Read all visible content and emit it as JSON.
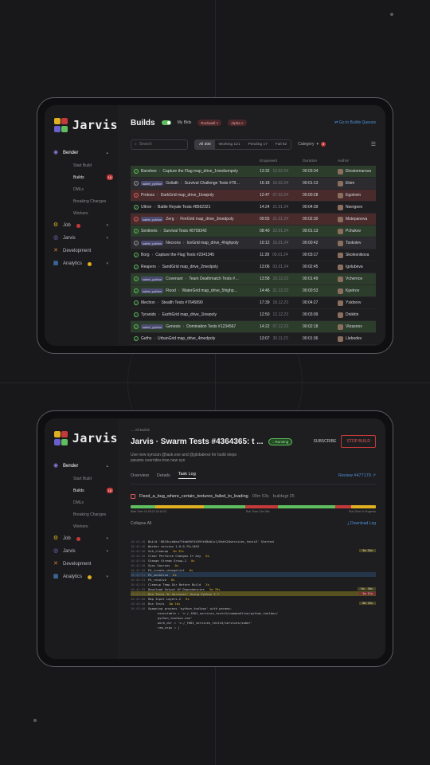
{
  "app_name": "Jarvis",
  "sidebar": {
    "groups": [
      {
        "label": "Bender",
        "icon": "bender-icon",
        "items": [
          {
            "label": "Start Build",
            "active": false
          },
          {
            "label": "Builds",
            "active": true,
            "count": "16"
          },
          {
            "label": "DMLs",
            "active": false
          },
          {
            "label": "Breaking Changes",
            "active": false
          },
          {
            "label": "Workers",
            "active": false
          }
        ]
      },
      {
        "label": "Job",
        "icon": "job-icon",
        "badge_color": "#c43a3a"
      },
      {
        "label": "Jarvis",
        "icon": "jarvis-icon"
      },
      {
        "label": "Development",
        "icon": "development-icon"
      },
      {
        "label": "Analytics",
        "icon": "analytics-icon",
        "badge_color": "#e0b020"
      }
    ]
  },
  "builds": {
    "title": "Builds",
    "toggle_label": "My Blds",
    "chips": [
      "Rockwell",
      "Alpha"
    ],
    "link": "Go to Builds Queues",
    "search_placeholder": "Search",
    "segments": [
      "All 300",
      "Working 121",
      "Pending 17",
      "Fail 62"
    ],
    "category_label": "Category",
    "category_count": "3",
    "columns": [
      "Enqueued",
      "Duration",
      "Author"
    ],
    "rows": [
      {
        "status": "green",
        "tag": "",
        "name": "Banshee",
        "task": "Capture the Flag map_drive_1mediumpoly",
        "time": "13:32",
        "date": "12.02.24",
        "dur": "00:03:34",
        "author": "Ekostomarova"
      },
      {
        "status": "grey",
        "tag": "saber_python",
        "name": "Goliath",
        "task": "Survival Challenge Tests #78…",
        "time": "16:18",
        "date": "10.02.24",
        "dur": "00:01:13",
        "author": "Ekim"
      },
      {
        "status": "red",
        "tag": "",
        "name": "Protoss",
        "task": "DarkGrid map_drive_1lowpoly",
        "time": "12:47",
        "date": "07.02.24",
        "dur": "00:00:28",
        "author": "Egolovin"
      },
      {
        "status": "none",
        "tag": "",
        "name": "Ultron",
        "task": "Battle Royale Tests #8562321",
        "time": "14:24",
        "date": "21.01.24",
        "dur": "00:04:39",
        "author": "Nsergeev"
      },
      {
        "status": "red",
        "tag": "saber_python",
        "name": "Zerg",
        "task": "FireGrid map_drive_3medpoly",
        "time": "09:55",
        "date": "21.01.24",
        "dur": "00:02:30",
        "author": "Mstepanova"
      },
      {
        "status": "green",
        "tag": "",
        "name": "Sentinels",
        "task": "Survival Tests #8759342",
        "time": "08:40",
        "date": "22.01.24",
        "dur": "00:01:13",
        "author": "Pchukov"
      },
      {
        "status": "grey",
        "tag": "saber_python",
        "name": "Necrons",
        "task": "IceGrid map_drive_4highpoly",
        "time": "10:12",
        "date": "15.01.24",
        "dur": "00:00:42",
        "author": "Tsokolev"
      },
      {
        "status": "none",
        "tag": "",
        "name": "Borg",
        "task": "Capture the Flag Tests #2341345",
        "time": "11:28",
        "date": "09.01.24",
        "dur": "00:03:17",
        "author": "Skolesnikova"
      },
      {
        "status": "none",
        "tag": "",
        "name": "Reapers",
        "task": "SandGrid map_drive_2medpoly",
        "time": "13:06",
        "date": "03.01.24",
        "dur": "00:02:45",
        "author": "Igolubeva"
      },
      {
        "status": "green",
        "tag": "saber_python",
        "name": "Covenant",
        "task": "Team Deathmatch Tests #…",
        "time": "13:58",
        "date": "29.12.23",
        "dur": "00:01:49",
        "author": "Vchernov"
      },
      {
        "status": "green",
        "tag": "saber_python",
        "name": "Flood",
        "task": "WaterGrid map_drive_5highp…",
        "time": "14:46",
        "date": "21.12.23",
        "dur": "00:00:53",
        "author": "Kpetrov"
      },
      {
        "status": "none",
        "tag": "",
        "name": "Mechon",
        "task": "Stealth Tests #7645890",
        "time": "17:39",
        "date": "18.12.23",
        "dur": "00:04:27",
        "author": "Ysidorov"
      },
      {
        "status": "none",
        "tag": "",
        "name": "Tyranids",
        "task": "EarthGrid map_drive_1lowpoly",
        "time": "12:50",
        "date": "12.12.23",
        "dur": "00:03:09",
        "author": "Dnikitin"
      },
      {
        "status": "green",
        "tag": "saber_python",
        "name": "Genesis",
        "task": "Domination Tests #1234567",
        "time": "14:22",
        "date": "07.12.23",
        "dur": "00:02:18",
        "author": "Vkrasnov"
      },
      {
        "status": "none",
        "tag": "",
        "name": "Geths",
        "task": "UrbanGrid map_drive_4medpoly",
        "time": "13:07",
        "date": "30.11.23",
        "dur": "00:01:36",
        "author": "Llebedev"
      }
    ]
  },
  "job": {
    "breadcrumb": "All Builds",
    "title": "Jarvis  ·  Swarm Tests #4364365: t ...",
    "status": "Running",
    "subscribe": "SUBSCRIBE",
    "stop": "STOP BUILD",
    "description": "Use new syncian @task.exe and @globalexe for build steps params overrides tree new syn",
    "tabs": [
      "Overview",
      "Details",
      "Task Log"
    ],
    "review": "Review #477179",
    "failure_name": "Fixed_a_bug_where_certain_textures_failed_to_loading",
    "failure_time": "00m 53s",
    "failure_agent": "buildagt 25",
    "timeline_start": "Start Time 10.08.23 15:16:24",
    "timeline_mid": "Run Time 13m 39s",
    "timeline_end": "Run Time In Progress",
    "collapse": "Collapse All",
    "download": "Download Log",
    "log": [
      {
        "ts": "16:42:48",
        "text": "Build '0819cce0ea7f4eb90f3459fe38db1c1/Emk%20services_tests3' Started",
        "style": ""
      },
      {
        "ts": "16:42:46",
        "text": "Worker version 1.0.0.75+1463",
        "style": ""
      },
      {
        "ts": "16:42:48",
        "text": "Ssh_cleanup",
        "dur": "5m 35s",
        "style": "",
        "right": "5m 34s"
      },
      {
        "ts": "16:42:50",
        "text": "Clear Perforce Changes If Any",
        "dur": "0s",
        "style": "",
        "right": ""
      },
      {
        "ts": "16:42:50",
        "text": "Change Stream Group-2",
        "dur": "0s",
        "style": "",
        "right": ""
      },
      {
        "ts": "16:42:50",
        "text": "Sync Sources",
        "dur": "0s",
        "style": "",
        "right": ""
      },
      {
        "ts": "16:42:50",
        "text": "P4_create_changelist",
        "dur": "0s",
        "style": "",
        "right": ""
      },
      {
        "ts": "16:42:51",
        "text": "P4_unshelve",
        "dur": "0s",
        "style": "cur",
        "right": ""
      },
      {
        "ts": "16:42:51",
        "text": "P4_resolve",
        "dur": "0s",
        "style": "",
        "right": ""
      },
      {
        "ts": "16:42:51",
        "text": "Cleanup Temp Dir Before Build",
        "dur": "3s",
        "style": "",
        "right": ""
      },
      {
        "ts": "16:42:55",
        "text": "Download Output Of Dependencies",
        "dur": "3m 39s",
        "style": "",
        "right": "Sm. 36s"
      },
      {
        "ts": "16:42:55",
        "text": "Run Tests In Services' Using Python 3.7",
        "dur": "",
        "style": "hl",
        "right": "2m 11s"
      },
      {
        "ts": "16:43:00",
        "text": "Map Input Layers-2",
        "dur": "0s",
        "style": "",
        "right": ""
      },
      {
        "ts": "16:43:00",
        "text": "Run Tests",
        "dur": "8m 16s",
        "style": "",
        "right": "8m 16s"
      },
      {
        "ts": "16:43:00",
        "text": "Spawning process 'python_toolbox' with params:",
        "style": "",
        "right": ""
      },
      {
        "ts": "",
        "text": "executable = 'c:/_f001_services_tests3/commandline/python_toolbox/",
        "style": "",
        "right": ""
      },
      {
        "ts": "",
        "text": "python_toolbox.exe'",
        "style": "",
        "right": ""
      },
      {
        "ts": "",
        "text": "work_dir = 'c:/_f001_services_tests3/services/saber'",
        "style": "",
        "right": ""
      },
      {
        "ts": "",
        "text": "raw_args = [",
        "style": "",
        "right": ""
      }
    ]
  }
}
